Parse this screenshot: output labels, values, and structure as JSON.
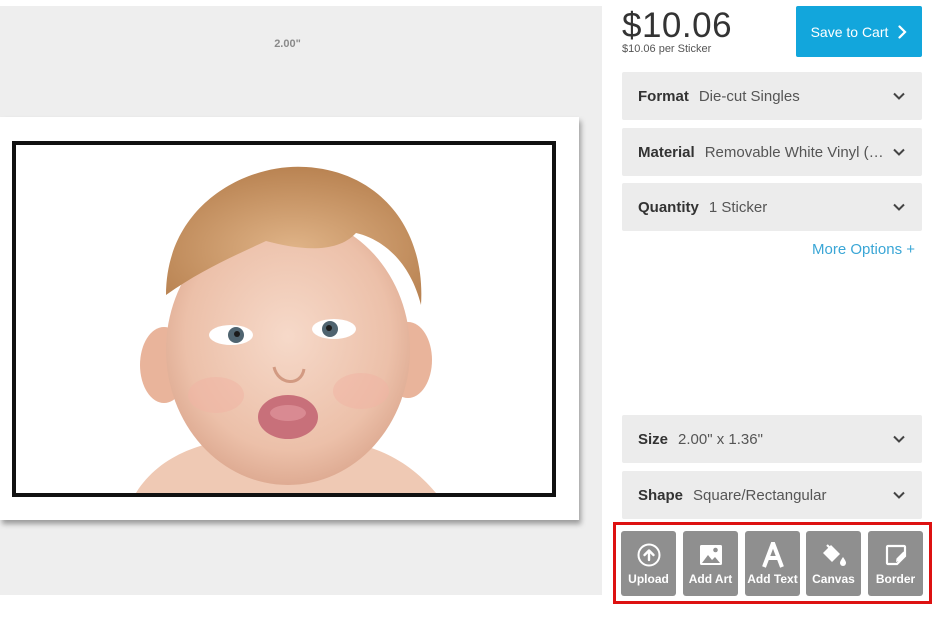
{
  "canvas": {
    "width_label": "2.00\""
  },
  "pricing": {
    "price": "$10.06",
    "per_unit": "$10.06 per Sticker",
    "cart_label": "Save to Cart"
  },
  "options": [
    {
      "key": "Format",
      "value": "Die-cut Singles"
    },
    {
      "key": "Material",
      "value": "Removable White Vinyl (S..."
    },
    {
      "key": "Quantity",
      "value": "1 Sticker"
    },
    {
      "key": "Size",
      "value": "2.00\" x 1.36\""
    },
    {
      "key": "Shape",
      "value": "Square/Rectangular"
    }
  ],
  "more_options": "More Options +",
  "tools": [
    {
      "label": "Upload",
      "icon": "upload-icon"
    },
    {
      "label": "Add Art",
      "icon": "image-icon"
    },
    {
      "label": "Add Text",
      "icon": "text-icon"
    },
    {
      "label": "Canvas",
      "icon": "paint-bucket-icon"
    },
    {
      "label": "Border",
      "icon": "border-edit-icon"
    }
  ],
  "colors": {
    "accent": "#12a6dc",
    "link": "#3aa6d6",
    "highlight": "#dd1111",
    "tool_bg": "#8f8f8f"
  }
}
